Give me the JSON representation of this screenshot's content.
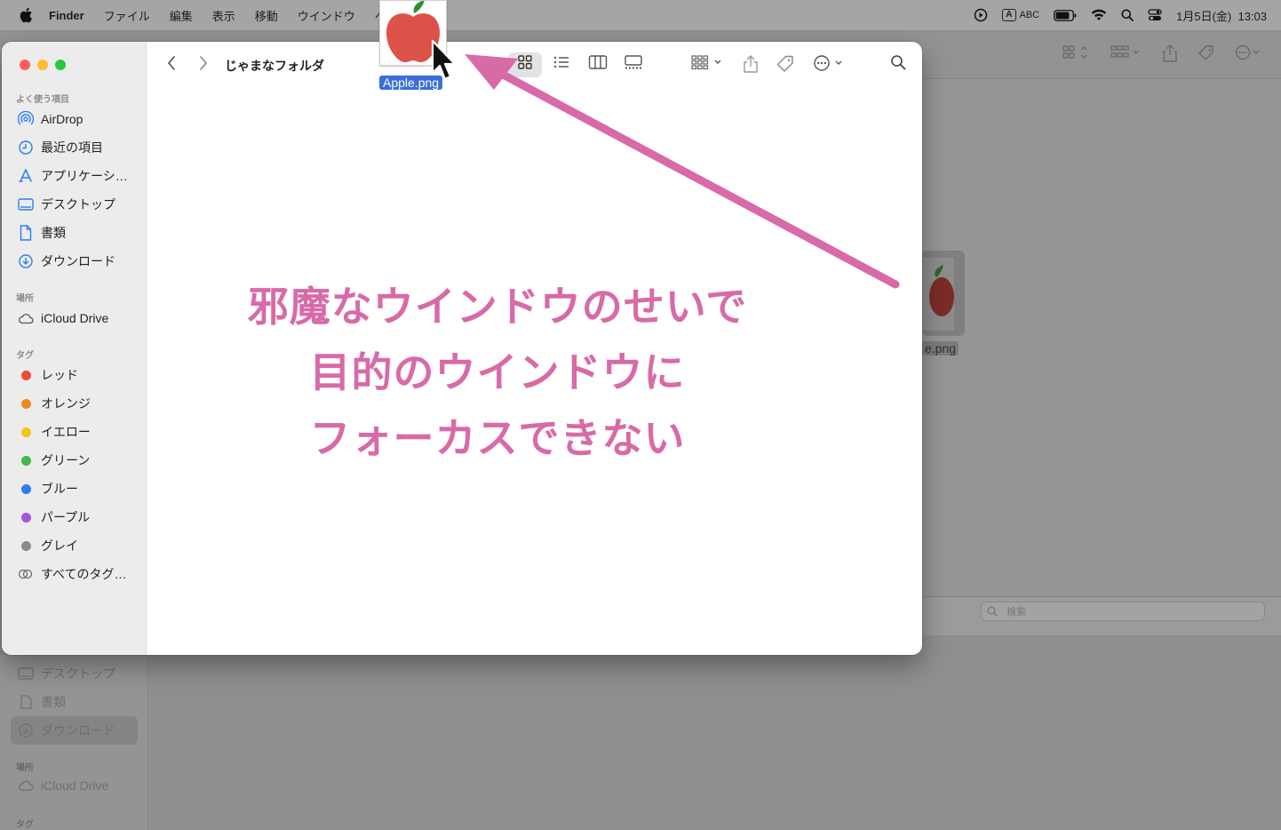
{
  "menubar": {
    "app": "Finder",
    "items": [
      "ファイル",
      "編集",
      "表示",
      "移動",
      "ウインドウ",
      "ヘ"
    ],
    "input_mode_badge": "A",
    "input_mode_label": "ABC",
    "datetime": "1月5日(金)  13:03"
  },
  "background_window": {
    "file_label": "e.png",
    "search_placeholder": "検索",
    "sidebar": {
      "items": [
        "デスクトップ",
        "書類",
        "ダウンロード"
      ],
      "section_places": "場所",
      "icloud": "iCloud Drive",
      "section_tags": "タグ"
    }
  },
  "window": {
    "folder_title": "じゃまなフォルダ",
    "sidebar": {
      "favorites_header": "よく使う項目",
      "favorites": [
        {
          "label": "AirDrop",
          "icon": "airdrop-icon"
        },
        {
          "label": "最近の項目",
          "icon": "clock-icon"
        },
        {
          "label": "アプリケーシ…",
          "icon": "applications-icon"
        },
        {
          "label": "デスクトップ",
          "icon": "desktop-icon"
        },
        {
          "label": "書類",
          "icon": "document-icon"
        },
        {
          "label": "ダウンロード",
          "icon": "download-icon"
        }
      ],
      "places_header": "場所",
      "places": [
        {
          "label": "iCloud Drive",
          "icon": "cloud-icon"
        }
      ],
      "tags_header": "タグ",
      "tags": [
        {
          "label": "レッド",
          "color": "#ef4a3c"
        },
        {
          "label": "オレンジ",
          "color": "#f08a1c"
        },
        {
          "label": "イエロー",
          "color": "#f6c21a"
        },
        {
          "label": "グリーン",
          "color": "#3fb94a"
        },
        {
          "label": "ブルー",
          "color": "#2f7cf0"
        },
        {
          "label": "パープル",
          "color": "#a356d6"
        },
        {
          "label": "グレイ",
          "color": "#8a8a8e"
        }
      ],
      "all_tags": "すべてのタグ…"
    }
  },
  "dragged_file": {
    "label": "Apple.png"
  },
  "annotation": {
    "lines": [
      "邪魔なウインドウのせいで",
      "目的のウインドウに",
      "フォーカスできない"
    ],
    "color": "#d86aa8"
  }
}
